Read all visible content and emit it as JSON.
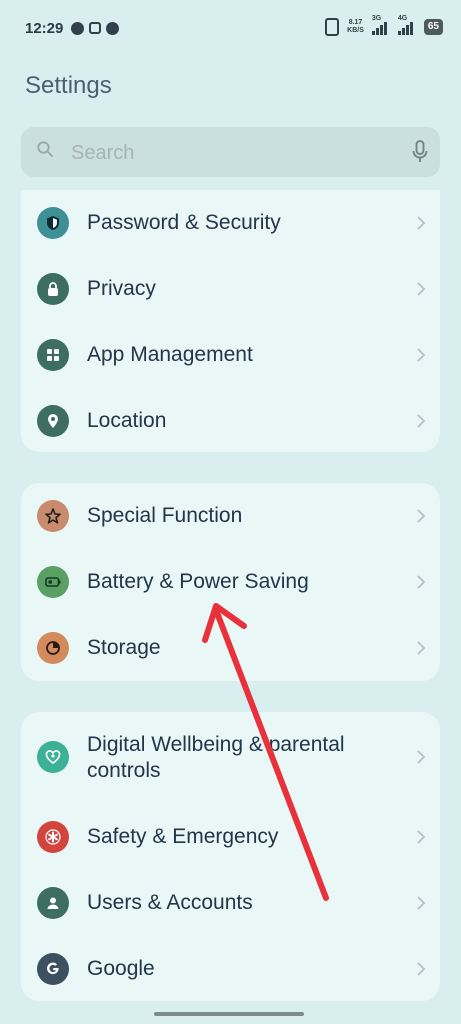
{
  "status_bar": {
    "time": "12:29",
    "net_speed_value": "8.17",
    "net_speed_unit": "KB/S",
    "sim1": "3G",
    "sim2": "4G",
    "battery": "65"
  },
  "title": "Settings",
  "search": {
    "placeholder": "Search"
  },
  "groups": [
    {
      "items": [
        {
          "label": "Password & Security",
          "icon": "shield-icon",
          "color": "#3e8f96"
        },
        {
          "label": "Privacy",
          "icon": "lock-icon",
          "color": "#3d6e60"
        },
        {
          "label": "App Management",
          "icon": "grid-icon",
          "color": "#3d6e60"
        },
        {
          "label": "Location",
          "icon": "location-pin-icon",
          "color": "#3d6e60"
        }
      ]
    },
    {
      "items": [
        {
          "label": "Special Function",
          "icon": "star-icon",
          "color": "#c98a6d"
        },
        {
          "label": "Battery & Power Saving",
          "icon": "battery-icon",
          "color": "#5aa064"
        },
        {
          "label": "Storage",
          "icon": "pie-chart-icon",
          "color": "#d38a5d"
        }
      ]
    },
    {
      "items": [
        {
          "label": "Digital Wellbeing & parental controls",
          "icon": "heart-person-icon",
          "color": "#3cb196"
        },
        {
          "label": "Safety & Emergency",
          "icon": "asterisk-icon",
          "color": "#d2453f"
        },
        {
          "label": "Users & Accounts",
          "icon": "user-icon",
          "color": "#3d6e60"
        },
        {
          "label": "Google",
          "icon": "google-icon",
          "color": "#3d5060"
        }
      ]
    }
  ],
  "colors": {
    "annotation_arrow": "#e8313a",
    "background": "#d9eeee",
    "card": "#e9f7f7"
  }
}
